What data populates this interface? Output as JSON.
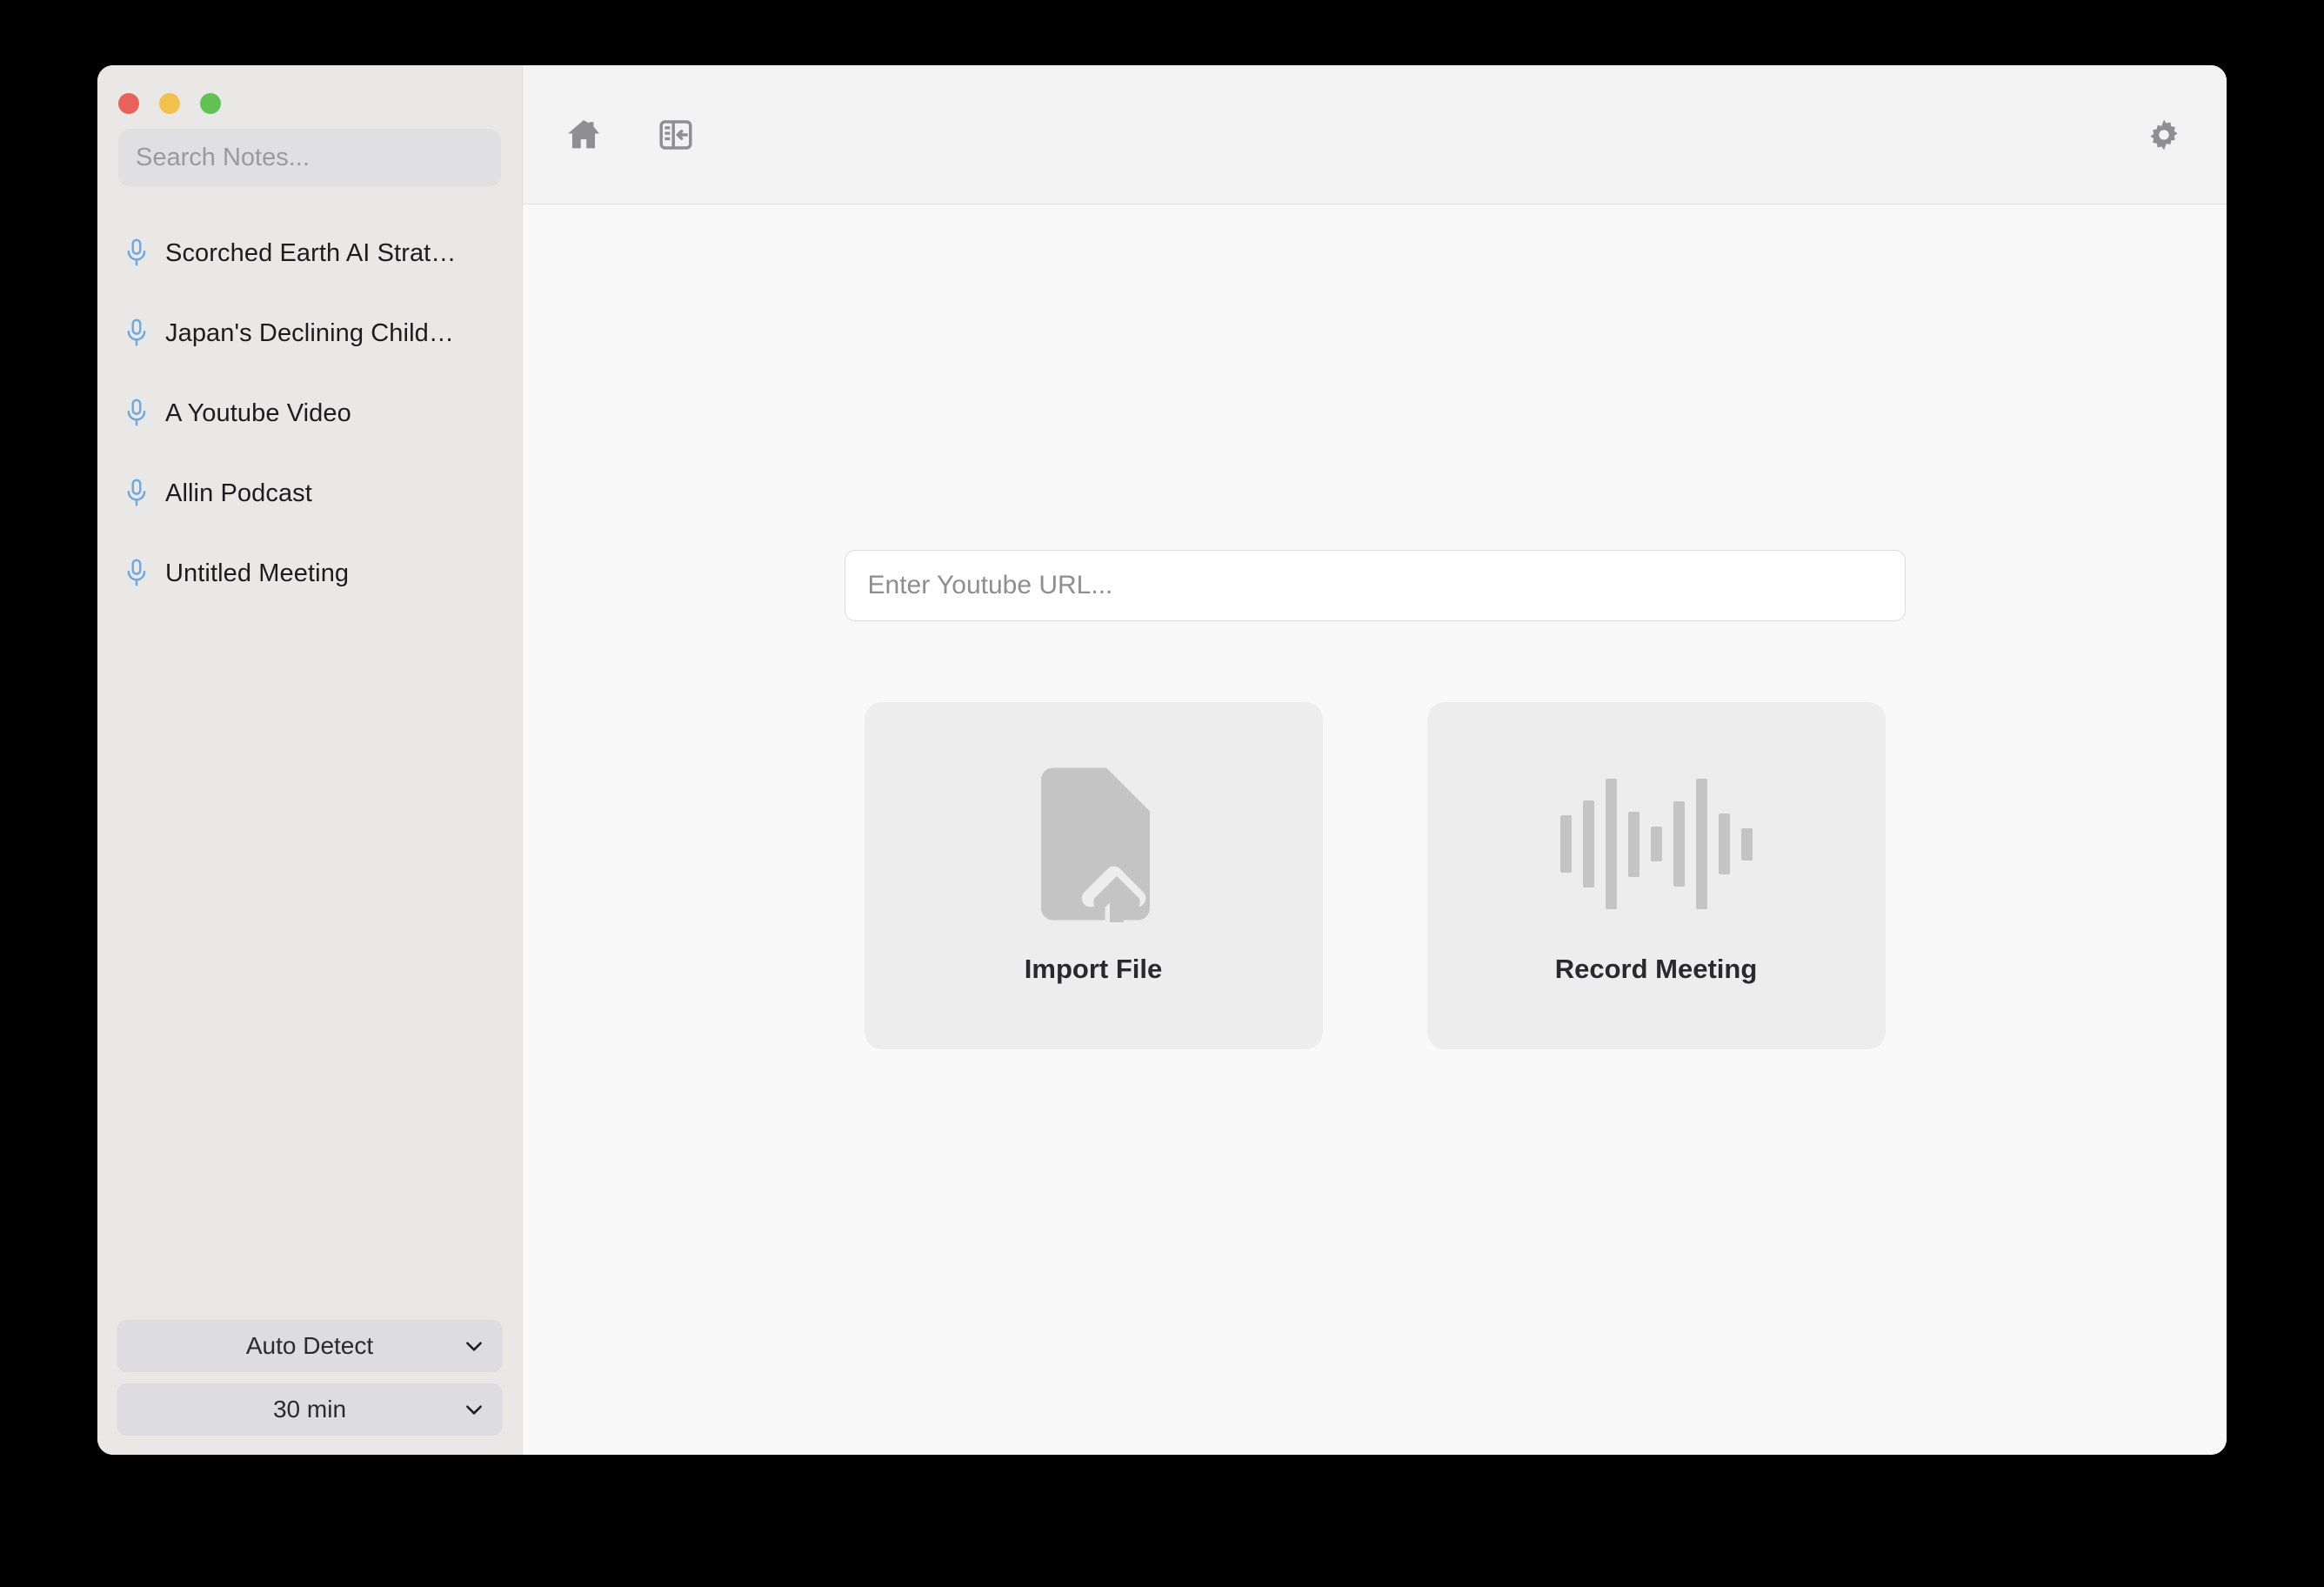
{
  "window": {
    "traffic_lights": [
      {
        "name": "close",
        "color": "#e8615a"
      },
      {
        "name": "minimize",
        "color": "#f2c04d"
      },
      {
        "name": "zoom",
        "color": "#5fc252"
      }
    ]
  },
  "sidebar": {
    "search": {
      "placeholder": "Search Notes...",
      "value": ""
    },
    "notes": [
      {
        "icon": "microphone-icon",
        "label": "Scorched Earth AI Strat…"
      },
      {
        "icon": "microphone-icon",
        "label": "Japan's Declining Child…"
      },
      {
        "icon": "microphone-icon",
        "label": "A Youtube Video"
      },
      {
        "icon": "microphone-icon",
        "label": "Allin Podcast"
      },
      {
        "icon": "microphone-icon",
        "label": "Untitled Meeting"
      }
    ],
    "footer": {
      "language_dropdown": {
        "label": "Auto Detect",
        "icon": "chevron-down-icon"
      },
      "duration_dropdown": {
        "label": "30 min",
        "icon": "chevron-down-icon"
      }
    }
  },
  "toolbar": {
    "home_icon": "home-icon",
    "sidebar_toggle_icon": "panel-collapse-icon",
    "settings_icon": "gear-icon"
  },
  "main": {
    "url_input": {
      "placeholder": "Enter Youtube URL...",
      "value": ""
    },
    "cards": [
      {
        "label": "Import File",
        "icon": "file-upload-icon"
      },
      {
        "label": "Record Meeting",
        "icon": "audio-waveform-icon"
      }
    ],
    "waveform_bar_heights": [
      66,
      100,
      150,
      75,
      40,
      98,
      150,
      70,
      37
    ]
  },
  "colors": {
    "accent_mic": "#6ea8dc",
    "icon_gray": "#8e8e93",
    "card_bg": "#eeeded",
    "sidebar_bg": "#e9e8e7",
    "toolbar_bg": "#f4f3f4",
    "main_bg": "#f9f9f9"
  }
}
